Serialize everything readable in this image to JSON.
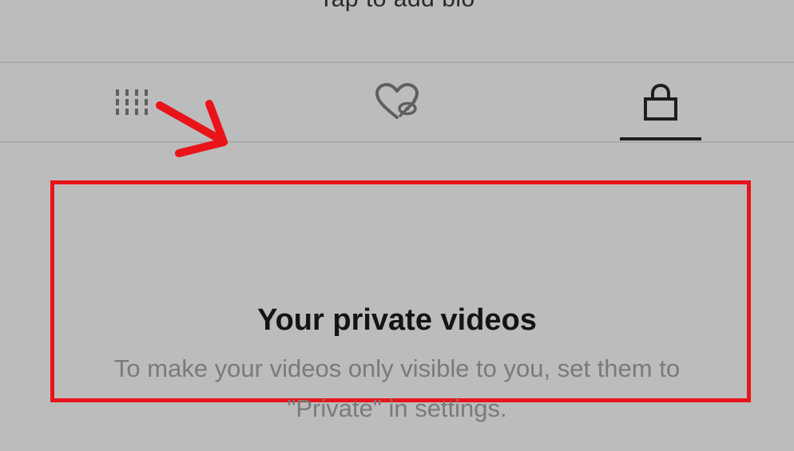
{
  "profile": {
    "bio_prompt": "Tap to add bio"
  },
  "tabs": [
    {
      "id": "videos",
      "icon": "grid-columns-icon",
      "selected": false
    },
    {
      "id": "liked",
      "icon": "hidden-heart-icon",
      "selected": false
    },
    {
      "id": "private",
      "icon": "lock-icon",
      "selected": true
    }
  ],
  "empty_state": {
    "title": "Your private videos",
    "description": "To make your videos only visible to you, set them to \"Private\" in settings."
  },
  "colors": {
    "background": "#bcbcbc",
    "annotation_red": "#e8141a",
    "title_text": "#141414",
    "secondary_text": "#7a7a7a",
    "icon_dark": "#1e1e1e",
    "icon_gray": "#5f5f5f"
  }
}
